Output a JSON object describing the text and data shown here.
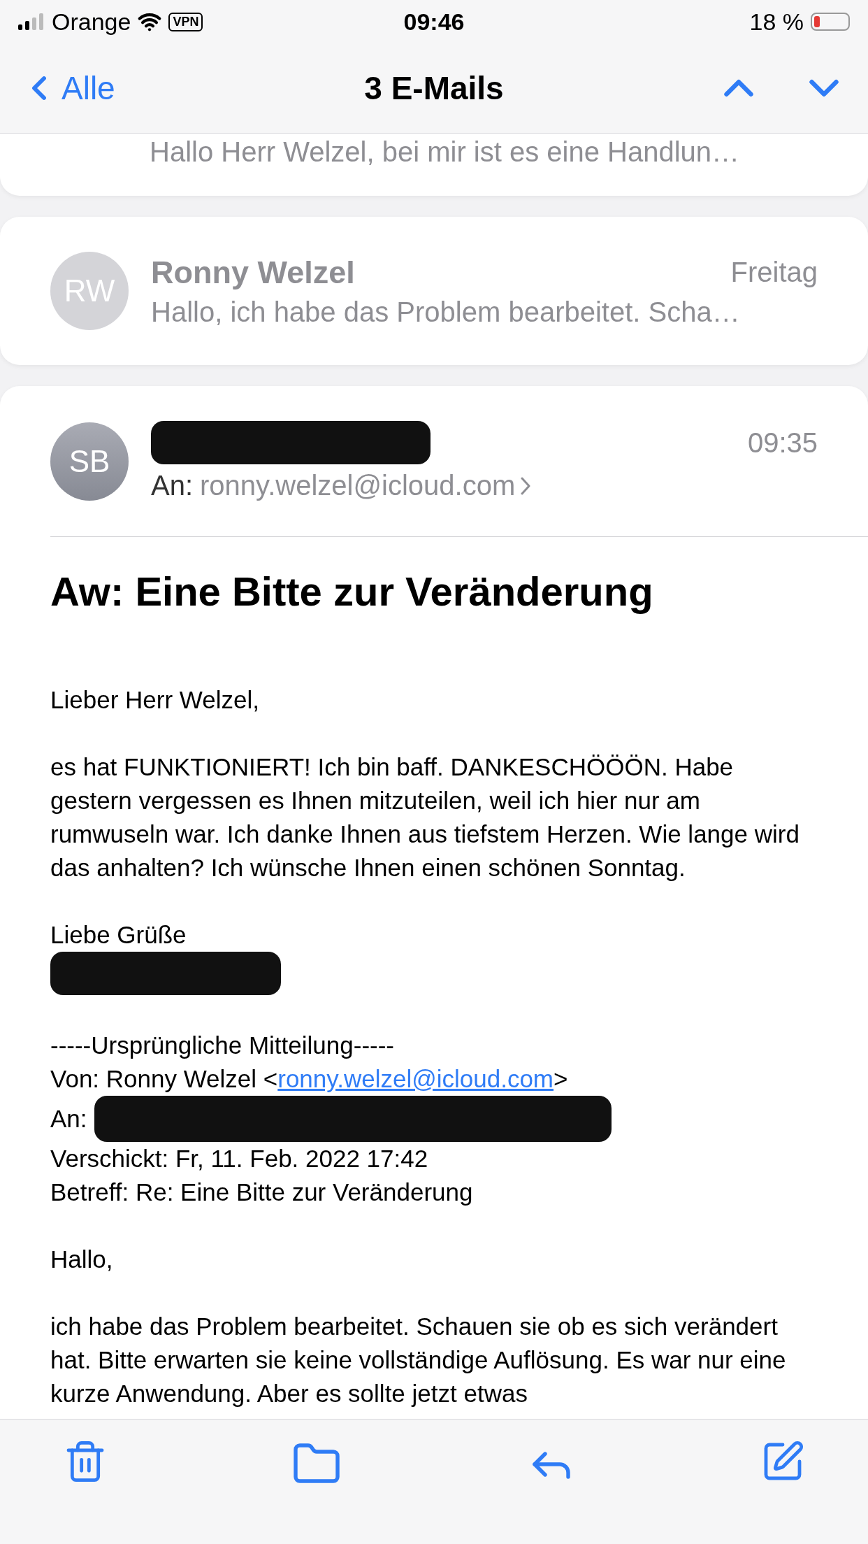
{
  "status_bar": {
    "carrier": "Orange",
    "vpn": "VPN",
    "time": "09:46",
    "battery": "18 %"
  },
  "nav": {
    "back": "Alle",
    "title": "3 E-Mails"
  },
  "thread": [
    {
      "kind": "cut",
      "preview": "Hallo Herr Welzel, bei mir ist es eine Handlun…"
    },
    {
      "kind": "collapsed",
      "initials": "RW",
      "sender": "Ronny Welzel",
      "date": "Freitag",
      "preview": "Hallo, ich habe das Problem bearbeitet. Scha…"
    }
  ],
  "message": {
    "initials": "SB",
    "sender_redacted": true,
    "time": "09:35",
    "to_label": "An:",
    "to": "ronny.welzel@icloud.com",
    "subject": "Aw: Eine Bitte zur Veränderung",
    "body": [
      {
        "kind": "paragraph",
        "text": "Lieber Herr Welzel,"
      },
      {
        "kind": "paragraph",
        "text": "es hat FUNKTIONIERT! Ich bin baff. DANKESCHÖÖÖN. Habe gestern vergessen es Ihnen mitzuteilen, weil ich hier nur am rumwuseln war. Ich danke Ihnen aus tiefstem Herzen. Wie lange wird das anhalten? Ich wünsche Ihnen einen schönen Sonntag."
      },
      {
        "kind": "signature",
        "text": "Liebe Grüße",
        "redacted": true
      },
      {
        "kind": "lines",
        "lines": [
          {
            "text": "-----Ursprüngliche Mitteilung-----",
            "redacted": false
          },
          {
            "text": "Von: Ronny Welzel <",
            "link": "ronny.welzel@icloud.com",
            "after": ">",
            "redacted": false
          },
          {
            "text": "An:",
            "redacted": true
          },
          {
            "text": "Verschickt: Fr, 11. Feb. 2022 17:42",
            "redacted": false
          },
          {
            "text": "Betreff: Re: Eine Bitte zur Veränderung",
            "redacted": false
          }
        ]
      },
      {
        "kind": "paragraph",
        "text": "Hallo,"
      },
      {
        "kind": "paragraph",
        "text": "ich habe das Problem bearbeitet. Schauen sie ob es sich verändert hat. Bitte erwarten sie keine vollständige Auflösung. Es war nur eine kurze Anwendung. Aber es sollte jetzt etwas"
      }
    ]
  }
}
